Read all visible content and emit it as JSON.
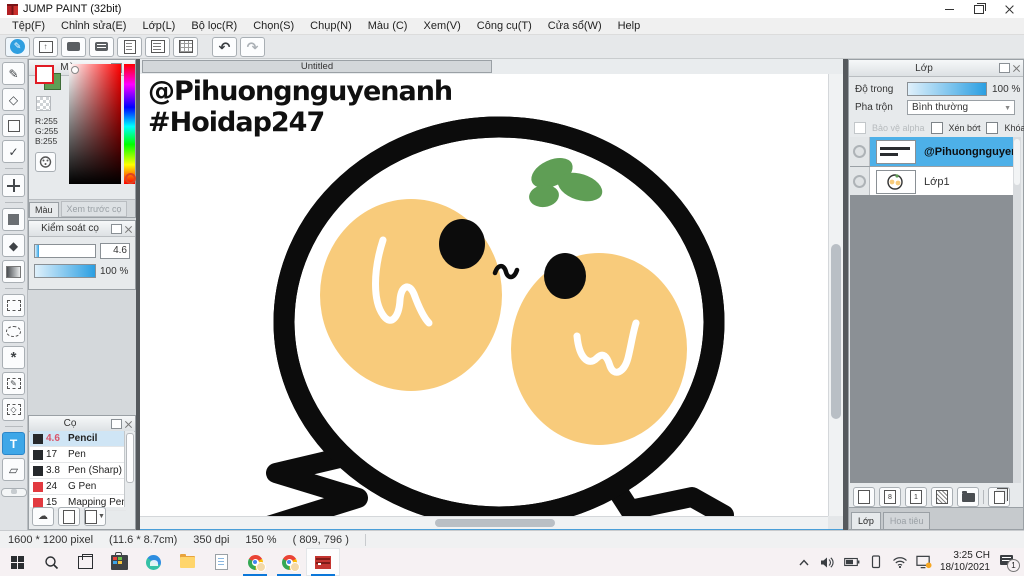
{
  "theme": {
    "accent": "#2f9fe0",
    "cheek": "#f8cb7b",
    "leaf": "#5f9e55",
    "selected_row": "#4db0e8",
    "taskbar_underline": "#0b77d9",
    "brush_size_red": "#d9556a"
  },
  "window": {
    "title": "JUMP PAINT (32bit)"
  },
  "menu": {
    "items": [
      "Tệp(F)",
      "Chỉnh sửa(E)",
      "Lớp(L)",
      "Bộ lọc(R)",
      "Chọn(S)",
      "Chụp(N)",
      "Màu (C)",
      "Xem(V)",
      "Công cụ(T)",
      "Cửa sổ(W)",
      "Help"
    ]
  },
  "color_panel": {
    "title": "Màu",
    "rgb": {
      "r": "R:255",
      "g": "G:255",
      "b": "B:255"
    },
    "tabs": [
      "Màu",
      "Xem trước cọ"
    ]
  },
  "brush_control": {
    "title": "Kiểm soát cọ",
    "size_value": "4.6",
    "opacity_value": "100 %"
  },
  "brush_panel": {
    "title": "Cọ",
    "brushes": [
      {
        "size": "4.6",
        "name": "Pencil"
      },
      {
        "size": "17",
        "name": "Pen"
      },
      {
        "size": "3.8",
        "name": "Pen (Sharp)"
      },
      {
        "size": "24",
        "name": "G Pen"
      },
      {
        "size": "15",
        "name": "Mapping Pen"
      }
    ]
  },
  "canvas": {
    "tab": "Untitled",
    "text_line1": "@Pihuongnguyenanh",
    "text_line2": "#Hoidap247"
  },
  "layer_panel": {
    "title": "Lớp",
    "opacity_label": "Độ trong",
    "opacity_value": "100 %",
    "blend_label": "Pha trộn",
    "blend_value": "Bình thường",
    "check_alpha": "Bảo vệ alpha",
    "check_clip": "Xén bớt",
    "check_lock": "Khóa",
    "layers": [
      {
        "name": "@Pihuongnguyenanh"
      },
      {
        "name": "Lớp1"
      }
    ],
    "tabs": [
      "Lớp",
      "Hoa tiêu"
    ]
  },
  "status_bar": {
    "dimensions": "1600 * 1200 pixel",
    "physical": "(11.6 * 8.7cm)",
    "dpi": "350 dpi",
    "zoom": "150 %",
    "cursor": "( 809, 796 )"
  },
  "taskbar": {
    "time": "3:25 CH",
    "date": "18/10/2021",
    "notification_count": "1"
  }
}
